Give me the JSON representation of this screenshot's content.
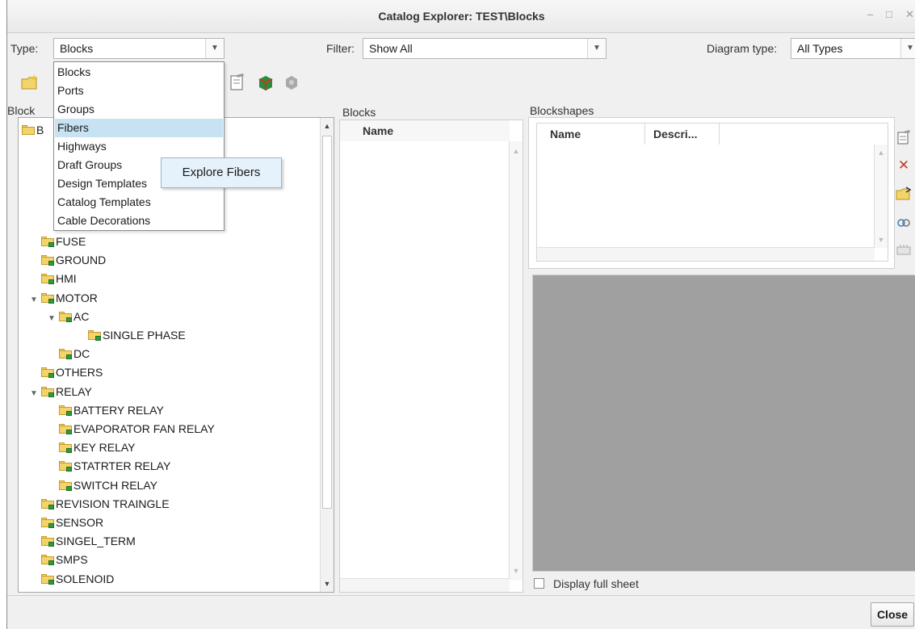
{
  "window": {
    "title": "Catalog Explorer: TEST\\Blocks"
  },
  "type": {
    "label": "Type:",
    "value": "Blocks"
  },
  "filter": {
    "label": "Filter:",
    "value": "Show All"
  },
  "diagram_type": {
    "label": "Diagram type:",
    "value": "All Types"
  },
  "type_dropdown": {
    "options": [
      "Blocks",
      "Ports",
      "Groups",
      "Fibers",
      "Highways",
      "Draft Groups",
      "Design Templates",
      "Catalog Templates",
      "Cable Decorations"
    ],
    "selected": "Fibers"
  },
  "tooltip": "Explore Fibers",
  "left_panel": {
    "title": "Block",
    "root_label": "B",
    "tree": [
      {
        "label": "FUSE",
        "level": 1,
        "expanded": false
      },
      {
        "label": "GROUND",
        "level": 1,
        "expanded": false
      },
      {
        "label": "HMI",
        "level": 1,
        "expanded": false
      },
      {
        "label": "MOTOR",
        "level": 1,
        "expanded": true
      },
      {
        "label": "AC",
        "level": 2,
        "expanded": true
      },
      {
        "label": "SINGLE PHASE",
        "level": 3,
        "expanded": false
      },
      {
        "label": "DC",
        "level": 2,
        "expanded": false
      },
      {
        "label": "OTHERS",
        "level": 1,
        "expanded": false
      },
      {
        "label": "RELAY",
        "level": 1,
        "expanded": true
      },
      {
        "label": "BATTERY RELAY",
        "level": 2,
        "expanded": false
      },
      {
        "label": "EVAPORATOR FAN RELAY",
        "level": 2,
        "expanded": false
      },
      {
        "label": "KEY RELAY",
        "level": 2,
        "expanded": false
      },
      {
        "label": "STATRTER RELAY",
        "level": 2,
        "expanded": false
      },
      {
        "label": "SWITCH RELAY",
        "level": 2,
        "expanded": false
      },
      {
        "label": "REVISION TRAINGLE",
        "level": 1,
        "expanded": false
      },
      {
        "label": "SENSOR",
        "level": 1,
        "expanded": false
      },
      {
        "label": "SINGEL_TERM",
        "level": 1,
        "expanded": false
      },
      {
        "label": "SMPS",
        "level": 1,
        "expanded": false
      },
      {
        "label": "SOLENOID",
        "level": 1,
        "expanded": false
      }
    ]
  },
  "blocks_panel": {
    "title": "Blocks",
    "col_name": "Name"
  },
  "blockshapes_panel": {
    "title": "Blockshapes",
    "col_name": "Name",
    "col_desc": "Descri..."
  },
  "display_full_sheet": {
    "label": "Display full sheet",
    "checked": false
  },
  "close_button": "Close",
  "colors": {
    "selection": "#c7e3f3",
    "preview_bg": "#a0a0a0",
    "window_bg": "#f0f0f0"
  }
}
